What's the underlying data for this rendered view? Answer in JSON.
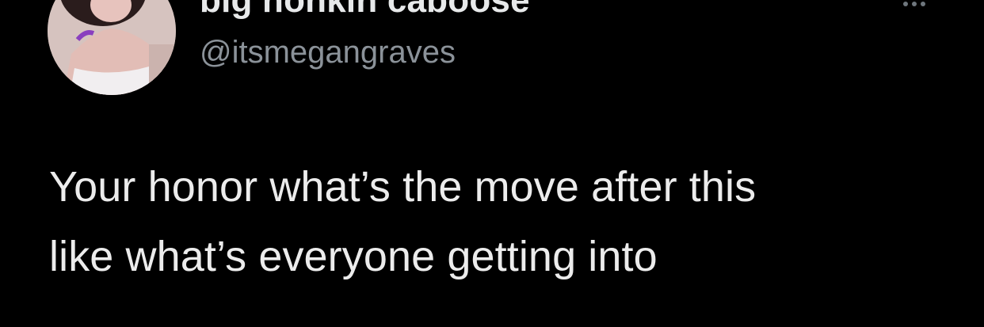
{
  "author": {
    "display_name": "big honkin caboose",
    "handle": "@itsmegangraves",
    "avatar_icon": "profile-photo"
  },
  "tweet": {
    "lines": [
      "Your honor what’s the move after this",
      "like what’s everyone getting into"
    ]
  },
  "actions": {
    "more_icon": "ellipsis-icon"
  },
  "colors": {
    "background": "#000000",
    "text": "#e7e9ea",
    "secondary_text": "#8b9299"
  }
}
